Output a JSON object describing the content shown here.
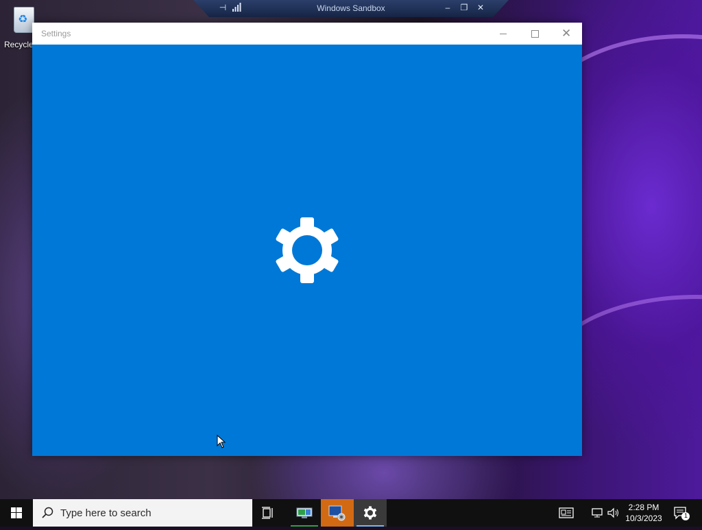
{
  "sandbox_bar": {
    "title": "Windows Sandbox",
    "icons": [
      "pin-icon",
      "signal-icon",
      "minimize-icon",
      "restore-icon",
      "close-icon"
    ]
  },
  "desktop": {
    "icons": [
      {
        "label": "Recycle Bin",
        "icon": "recycle-bin-icon"
      }
    ]
  },
  "window": {
    "title": "Settings",
    "splash_icon": "gear-icon",
    "background_color": "#0078d7",
    "controls": [
      "minimize",
      "maximize",
      "close"
    ]
  },
  "taskbar": {
    "search_placeholder": "Type here to search",
    "pinned": [
      {
        "name": "task-view",
        "icon": "task-view-icon"
      },
      {
        "name": "app",
        "icon": "network-app-icon",
        "accent": "#2ea043"
      },
      {
        "name": "app",
        "icon": "remote-desktop-icon",
        "background": "#d26a14"
      },
      {
        "name": "settings",
        "icon": "gear-icon",
        "accent": "#79b8f3"
      }
    ],
    "tray": {
      "time": "2:28 PM",
      "date": "10/3/2023",
      "notification_count": "1"
    }
  }
}
